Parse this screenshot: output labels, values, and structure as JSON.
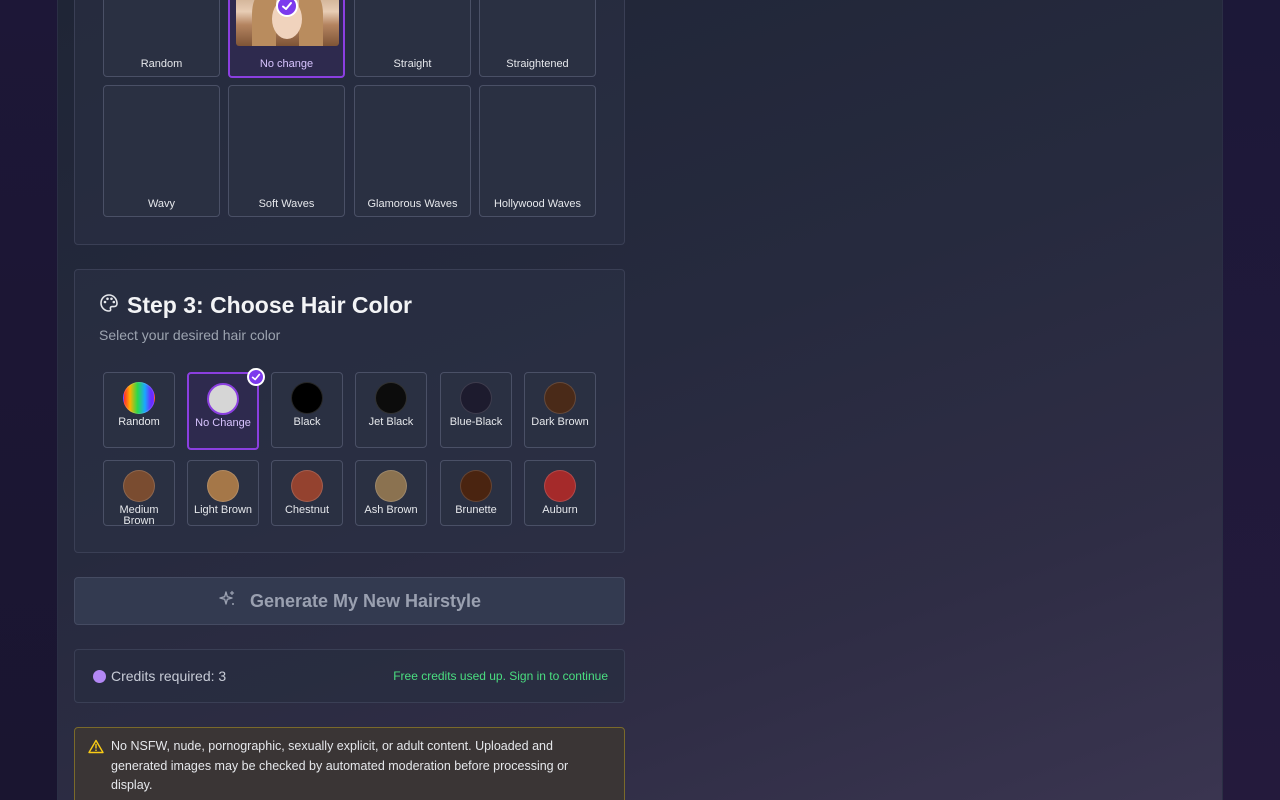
{
  "hair_styles": [
    {
      "label": "Random",
      "selected": false
    },
    {
      "label": "No change",
      "selected": true
    },
    {
      "label": "Straight",
      "selected": false
    },
    {
      "label": "Straightened",
      "selected": false
    },
    {
      "label": "Wavy",
      "selected": false
    },
    {
      "label": "Soft Waves",
      "selected": false
    },
    {
      "label": "Glamorous Waves",
      "selected": false
    },
    {
      "label": "Hollywood Waves",
      "selected": false
    }
  ],
  "step3": {
    "title": "Step 3: Choose Hair Color",
    "subtitle": "Select your desired hair color",
    "icon": "palette-icon",
    "colors": [
      {
        "label": "Random",
        "swatch": "rainbow",
        "selected": false
      },
      {
        "label": "No Change",
        "swatch": "#d6d6d6",
        "selected": true
      },
      {
        "label": "Black",
        "swatch": "#000000",
        "selected": false
      },
      {
        "label": "Jet Black",
        "swatch": "#0c0c0c",
        "selected": false
      },
      {
        "label": "Blue-Black",
        "swatch": "#1d1b2e",
        "selected": false
      },
      {
        "label": "Dark Brown",
        "swatch": "#4a2a18",
        "selected": false
      },
      {
        "label": "Medium Brown",
        "swatch": "#7a4c30",
        "selected": false
      },
      {
        "label": "Light Brown",
        "swatch": "#a57748",
        "selected": false
      },
      {
        "label": "Chestnut",
        "swatch": "#94422f",
        "selected": false
      },
      {
        "label": "Ash Brown",
        "swatch": "#8b7250",
        "selected": false
      },
      {
        "label": "Brunette",
        "swatch": "#4a2410",
        "selected": false
      },
      {
        "label": "Auburn",
        "swatch": "#a52a2a",
        "selected": false
      }
    ]
  },
  "generate_button": {
    "label": "Generate My New Hairstyle",
    "icon": "sparkles-icon"
  },
  "credits": {
    "required_text": "Credits required: 3",
    "status_text": "Free credits used up. Sign in to continue"
  },
  "notice": {
    "icon": "warning-icon",
    "text": "No NSFW, nude, pornographic, sexually explicit, or adult content. Uploaded and generated images may be checked by automated moderation before processing or display."
  },
  "colors": {
    "accent": "#7c3aed",
    "success": "#4ade80",
    "warning": "#facc15"
  }
}
